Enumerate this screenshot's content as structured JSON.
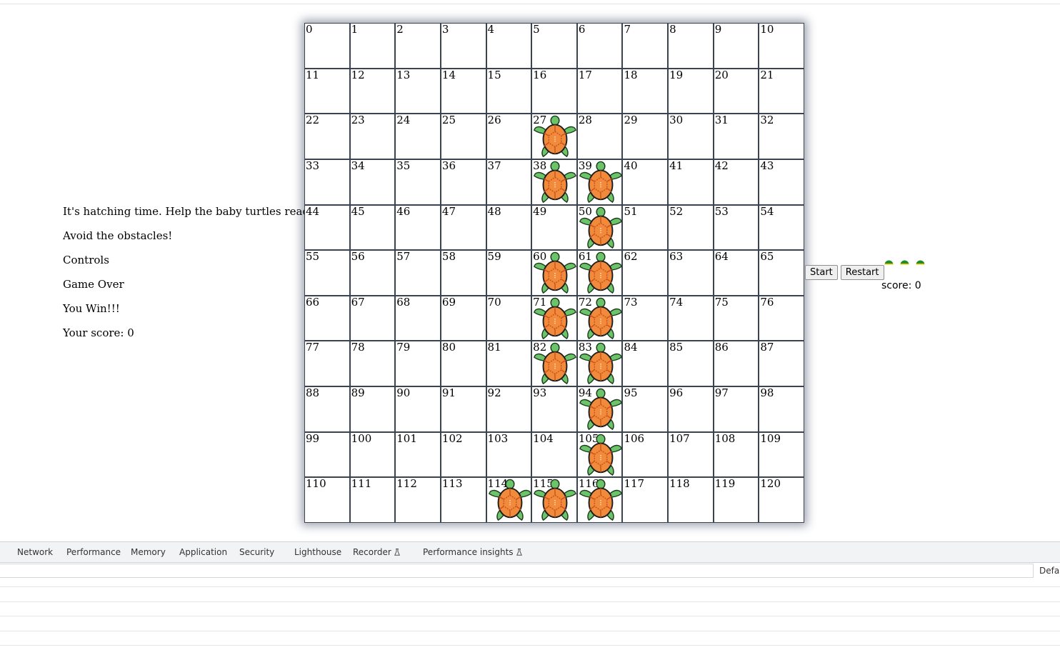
{
  "intro": {
    "line1": "It's hatching time. Help the baby turtles reach the sea",
    "line2": "Avoid the obstacles!",
    "line3": "Controls",
    "line4": "Game Over",
    "line5": "You Win!!!",
    "line6": "Your score: 0"
  },
  "board": {
    "columns": 11,
    "rows": 11,
    "turtle_cells": [
      27,
      38,
      39,
      50,
      60,
      61,
      71,
      72,
      82,
      83,
      94,
      105,
      114,
      115,
      116
    ]
  },
  "controls": {
    "start_label": "Start",
    "restart_label": "Restart"
  },
  "lives": {
    "count": 3,
    "color": "#1a8f2a"
  },
  "score": {
    "text": "score: 0"
  },
  "colors": {
    "shell": "#f28a3c",
    "shell_dark": "#c9541f",
    "flipper": "#6cc46a",
    "grid_border": "#3b4350"
  },
  "devtools": {
    "tabs": [
      "Network",
      "Performance",
      "Memory",
      "Application",
      "Security",
      "Lighthouse",
      "Recorder",
      "Performance insights"
    ],
    "default_label": "Defau"
  }
}
